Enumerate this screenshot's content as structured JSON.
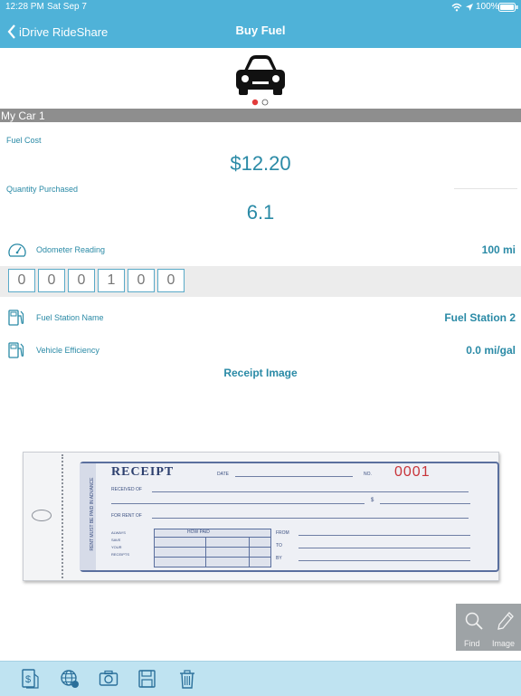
{
  "status": {
    "time": "12:28 PM",
    "date": "Sat Sep 7",
    "battery": "100%"
  },
  "nav": {
    "back_label": "iDrive RideShare",
    "title": "Buy Fuel"
  },
  "section_header": "My Car 1",
  "fuel_cost": {
    "label": "Fuel Cost",
    "value": "$12.20"
  },
  "quantity": {
    "label": "Quantity Purchased",
    "value": "6.1"
  },
  "odometer": {
    "label": "Odometer Reading",
    "value": "100 mi",
    "digits": [
      "0",
      "0",
      "0",
      "1",
      "0",
      "0"
    ]
  },
  "station": {
    "label": "Fuel Station Name",
    "value": "Fuel Station 2"
  },
  "efficiency": {
    "label": "Vehicle Efficiency",
    "value": "0.0 mi/gal"
  },
  "receipt": {
    "heading": "Receipt Image",
    "title": "RECEIPT",
    "number": "0001",
    "date_label": "DATE",
    "no_label": "NO.",
    "received_label": "RECEIVED OF",
    "for_rent_label": "FOR RENT OF",
    "how_paid": "HOW PAID",
    "from_label": "FROM",
    "to_label": "TO",
    "by_label": "BY",
    "always": "ALWAYS",
    "save": "SAVE",
    "your": "YOUR",
    "receipts": "RECEIPTS",
    "side_text": "RENT MUST BE PAID IN ADVANCE",
    "dollar": "$"
  },
  "find_panel": {
    "find_label": "Find",
    "image_label": "Image"
  },
  "carousel": {
    "active_color": "#e23b3b"
  }
}
